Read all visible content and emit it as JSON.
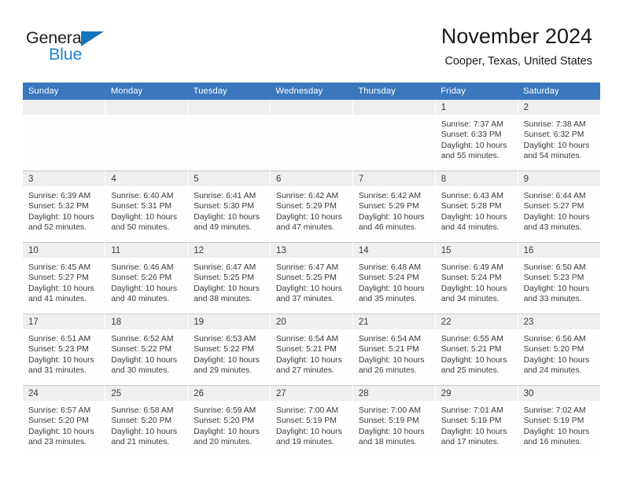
{
  "brand": {
    "name_part1": "General",
    "name_part2": "Blue",
    "triangle_color": "#1574bb",
    "blue_text_color": "#1d86d4"
  },
  "header": {
    "title": "November 2024",
    "subtitle": "Cooper, Texas, United States"
  },
  "theme": {
    "header_bg": "#3b77bd",
    "header_text": "#ffffff",
    "daynum_bg": "#efefef",
    "cell_bg": "#fefefe",
    "grid_line": "#c8c8c8"
  },
  "weekday_headers": [
    "Sunday",
    "Monday",
    "Tuesday",
    "Wednesday",
    "Thursday",
    "Friday",
    "Saturday"
  ],
  "labels": {
    "sunrise": "Sunrise:",
    "sunset": "Sunset:",
    "daylight": "Daylight:"
  },
  "weeks": [
    [
      {
        "day": "",
        "sunrise": "",
        "sunset": "",
        "daylight": ""
      },
      {
        "day": "",
        "sunrise": "",
        "sunset": "",
        "daylight": ""
      },
      {
        "day": "",
        "sunrise": "",
        "sunset": "",
        "daylight": ""
      },
      {
        "day": "",
        "sunrise": "",
        "sunset": "",
        "daylight": ""
      },
      {
        "day": "",
        "sunrise": "",
        "sunset": "",
        "daylight": ""
      },
      {
        "day": "1",
        "sunrise": "Sunrise: 7:37 AM",
        "sunset": "Sunset: 6:33 PM",
        "daylight": "Daylight: 10 hours and 55 minutes."
      },
      {
        "day": "2",
        "sunrise": "Sunrise: 7:38 AM",
        "sunset": "Sunset: 6:32 PM",
        "daylight": "Daylight: 10 hours and 54 minutes."
      }
    ],
    [
      {
        "day": "3",
        "sunrise": "Sunrise: 6:39 AM",
        "sunset": "Sunset: 5:32 PM",
        "daylight": "Daylight: 10 hours and 52 minutes."
      },
      {
        "day": "4",
        "sunrise": "Sunrise: 6:40 AM",
        "sunset": "Sunset: 5:31 PM",
        "daylight": "Daylight: 10 hours and 50 minutes."
      },
      {
        "day": "5",
        "sunrise": "Sunrise: 6:41 AM",
        "sunset": "Sunset: 5:30 PM",
        "daylight": "Daylight: 10 hours and 49 minutes."
      },
      {
        "day": "6",
        "sunrise": "Sunrise: 6:42 AM",
        "sunset": "Sunset: 5:29 PM",
        "daylight": "Daylight: 10 hours and 47 minutes."
      },
      {
        "day": "7",
        "sunrise": "Sunrise: 6:42 AM",
        "sunset": "Sunset: 5:29 PM",
        "daylight": "Daylight: 10 hours and 46 minutes."
      },
      {
        "day": "8",
        "sunrise": "Sunrise: 6:43 AM",
        "sunset": "Sunset: 5:28 PM",
        "daylight": "Daylight: 10 hours and 44 minutes."
      },
      {
        "day": "9",
        "sunrise": "Sunrise: 6:44 AM",
        "sunset": "Sunset: 5:27 PM",
        "daylight": "Daylight: 10 hours and 43 minutes."
      }
    ],
    [
      {
        "day": "10",
        "sunrise": "Sunrise: 6:45 AM",
        "sunset": "Sunset: 5:27 PM",
        "daylight": "Daylight: 10 hours and 41 minutes."
      },
      {
        "day": "11",
        "sunrise": "Sunrise: 6:46 AM",
        "sunset": "Sunset: 5:26 PM",
        "daylight": "Daylight: 10 hours and 40 minutes."
      },
      {
        "day": "12",
        "sunrise": "Sunrise: 6:47 AM",
        "sunset": "Sunset: 5:25 PM",
        "daylight": "Daylight: 10 hours and 38 minutes."
      },
      {
        "day": "13",
        "sunrise": "Sunrise: 6:47 AM",
        "sunset": "Sunset: 5:25 PM",
        "daylight": "Daylight: 10 hours and 37 minutes."
      },
      {
        "day": "14",
        "sunrise": "Sunrise: 6:48 AM",
        "sunset": "Sunset: 5:24 PM",
        "daylight": "Daylight: 10 hours and 35 minutes."
      },
      {
        "day": "15",
        "sunrise": "Sunrise: 6:49 AM",
        "sunset": "Sunset: 5:24 PM",
        "daylight": "Daylight: 10 hours and 34 minutes."
      },
      {
        "day": "16",
        "sunrise": "Sunrise: 6:50 AM",
        "sunset": "Sunset: 5:23 PM",
        "daylight": "Daylight: 10 hours and 33 minutes."
      }
    ],
    [
      {
        "day": "17",
        "sunrise": "Sunrise: 6:51 AM",
        "sunset": "Sunset: 5:23 PM",
        "daylight": "Daylight: 10 hours and 31 minutes."
      },
      {
        "day": "18",
        "sunrise": "Sunrise: 6:52 AM",
        "sunset": "Sunset: 5:22 PM",
        "daylight": "Daylight: 10 hours and 30 minutes."
      },
      {
        "day": "19",
        "sunrise": "Sunrise: 6:53 AM",
        "sunset": "Sunset: 5:22 PM",
        "daylight": "Daylight: 10 hours and 29 minutes."
      },
      {
        "day": "20",
        "sunrise": "Sunrise: 6:54 AM",
        "sunset": "Sunset: 5:21 PM",
        "daylight": "Daylight: 10 hours and 27 minutes."
      },
      {
        "day": "21",
        "sunrise": "Sunrise: 6:54 AM",
        "sunset": "Sunset: 5:21 PM",
        "daylight": "Daylight: 10 hours and 26 minutes."
      },
      {
        "day": "22",
        "sunrise": "Sunrise: 6:55 AM",
        "sunset": "Sunset: 5:21 PM",
        "daylight": "Daylight: 10 hours and 25 minutes."
      },
      {
        "day": "23",
        "sunrise": "Sunrise: 6:56 AM",
        "sunset": "Sunset: 5:20 PM",
        "daylight": "Daylight: 10 hours and 24 minutes."
      }
    ],
    [
      {
        "day": "24",
        "sunrise": "Sunrise: 6:57 AM",
        "sunset": "Sunset: 5:20 PM",
        "daylight": "Daylight: 10 hours and 23 minutes."
      },
      {
        "day": "25",
        "sunrise": "Sunrise: 6:58 AM",
        "sunset": "Sunset: 5:20 PM",
        "daylight": "Daylight: 10 hours and 21 minutes."
      },
      {
        "day": "26",
        "sunrise": "Sunrise: 6:59 AM",
        "sunset": "Sunset: 5:20 PM",
        "daylight": "Daylight: 10 hours and 20 minutes."
      },
      {
        "day": "27",
        "sunrise": "Sunrise: 7:00 AM",
        "sunset": "Sunset: 5:19 PM",
        "daylight": "Daylight: 10 hours and 19 minutes."
      },
      {
        "day": "28",
        "sunrise": "Sunrise: 7:00 AM",
        "sunset": "Sunset: 5:19 PM",
        "daylight": "Daylight: 10 hours and 18 minutes."
      },
      {
        "day": "29",
        "sunrise": "Sunrise: 7:01 AM",
        "sunset": "Sunset: 5:19 PM",
        "daylight": "Daylight: 10 hours and 17 minutes."
      },
      {
        "day": "30",
        "sunrise": "Sunrise: 7:02 AM",
        "sunset": "Sunset: 5:19 PM",
        "daylight": "Daylight: 10 hours and 16 minutes."
      }
    ]
  ]
}
